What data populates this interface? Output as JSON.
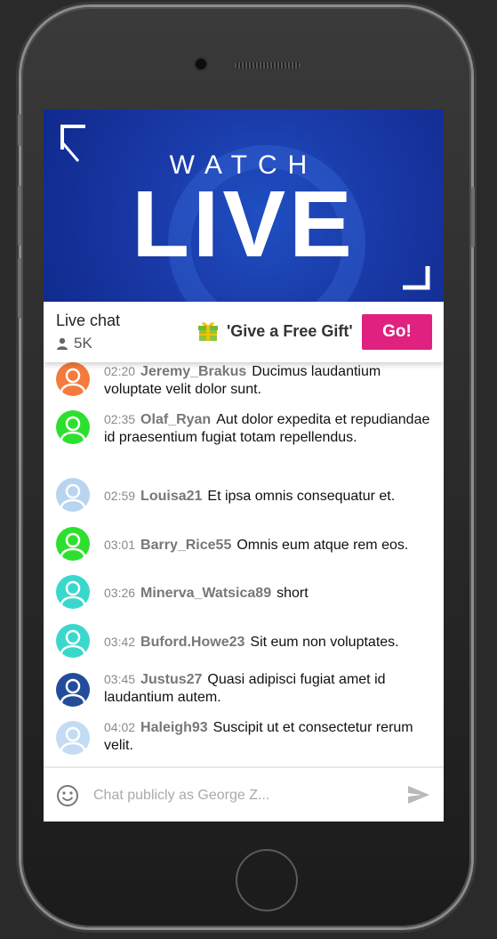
{
  "hero": {
    "title_small": "WATCH",
    "title_big": "LIVE"
  },
  "chat_header": {
    "title": "Live chat",
    "viewers": "5K",
    "gift_text": "'Give a Free Gift'",
    "go_label": "Go!"
  },
  "messages": [
    {
      "time": "02:20",
      "user": "Jeremy_Brakus",
      "text": "Ducimus laudantium voluptate velit dolor sunt.",
      "avatar_color": "#f47b3c"
    },
    {
      "time": "02:35",
      "user": "Olaf_Ryan",
      "text": "Aut dolor expedita et repudiandae id praesentium fugiat totam repellendus.",
      "avatar_color": "#2ee02e"
    },
    {
      "time": "02:59",
      "user": "Louisa21",
      "text": "Et ipsa omnis consequatur et.",
      "avatar_color": "#b9d4ef"
    },
    {
      "time": "03:01",
      "user": "Barry_Rice55",
      "text": "Omnis eum atque rem eos.",
      "avatar_color": "#2ee02e"
    },
    {
      "time": "03:26",
      "user": "Minerva_Watsica89",
      "text": "short",
      "avatar_color": "#3ad8cc"
    },
    {
      "time": "03:42",
      "user": "Buford.Howe23",
      "text": "Sit eum non voluptates.",
      "avatar_color": "#3ad8cc"
    },
    {
      "time": "03:45",
      "user": "Justus27",
      "text": "Quasi adipisci fugiat amet id laudantium autem.",
      "avatar_color": "#234d9a"
    },
    {
      "time": "04:02",
      "user": "Haleigh93",
      "text": "Suscipit ut et consectetur rerum velit.",
      "avatar_color": "#c4dcf3"
    }
  ],
  "input": {
    "placeholder": "Chat publicly as George Z..."
  },
  "icons": {
    "viewers": "person-icon",
    "gift": "gift-icon",
    "emoji": "smiley-icon",
    "send": "send-icon",
    "corner_tl": "corner-bracket-icon",
    "corner_br": "corner-bracket-icon"
  },
  "colors": {
    "accent": "#e0217f",
    "hero_blue": "#1a3aa8"
  }
}
